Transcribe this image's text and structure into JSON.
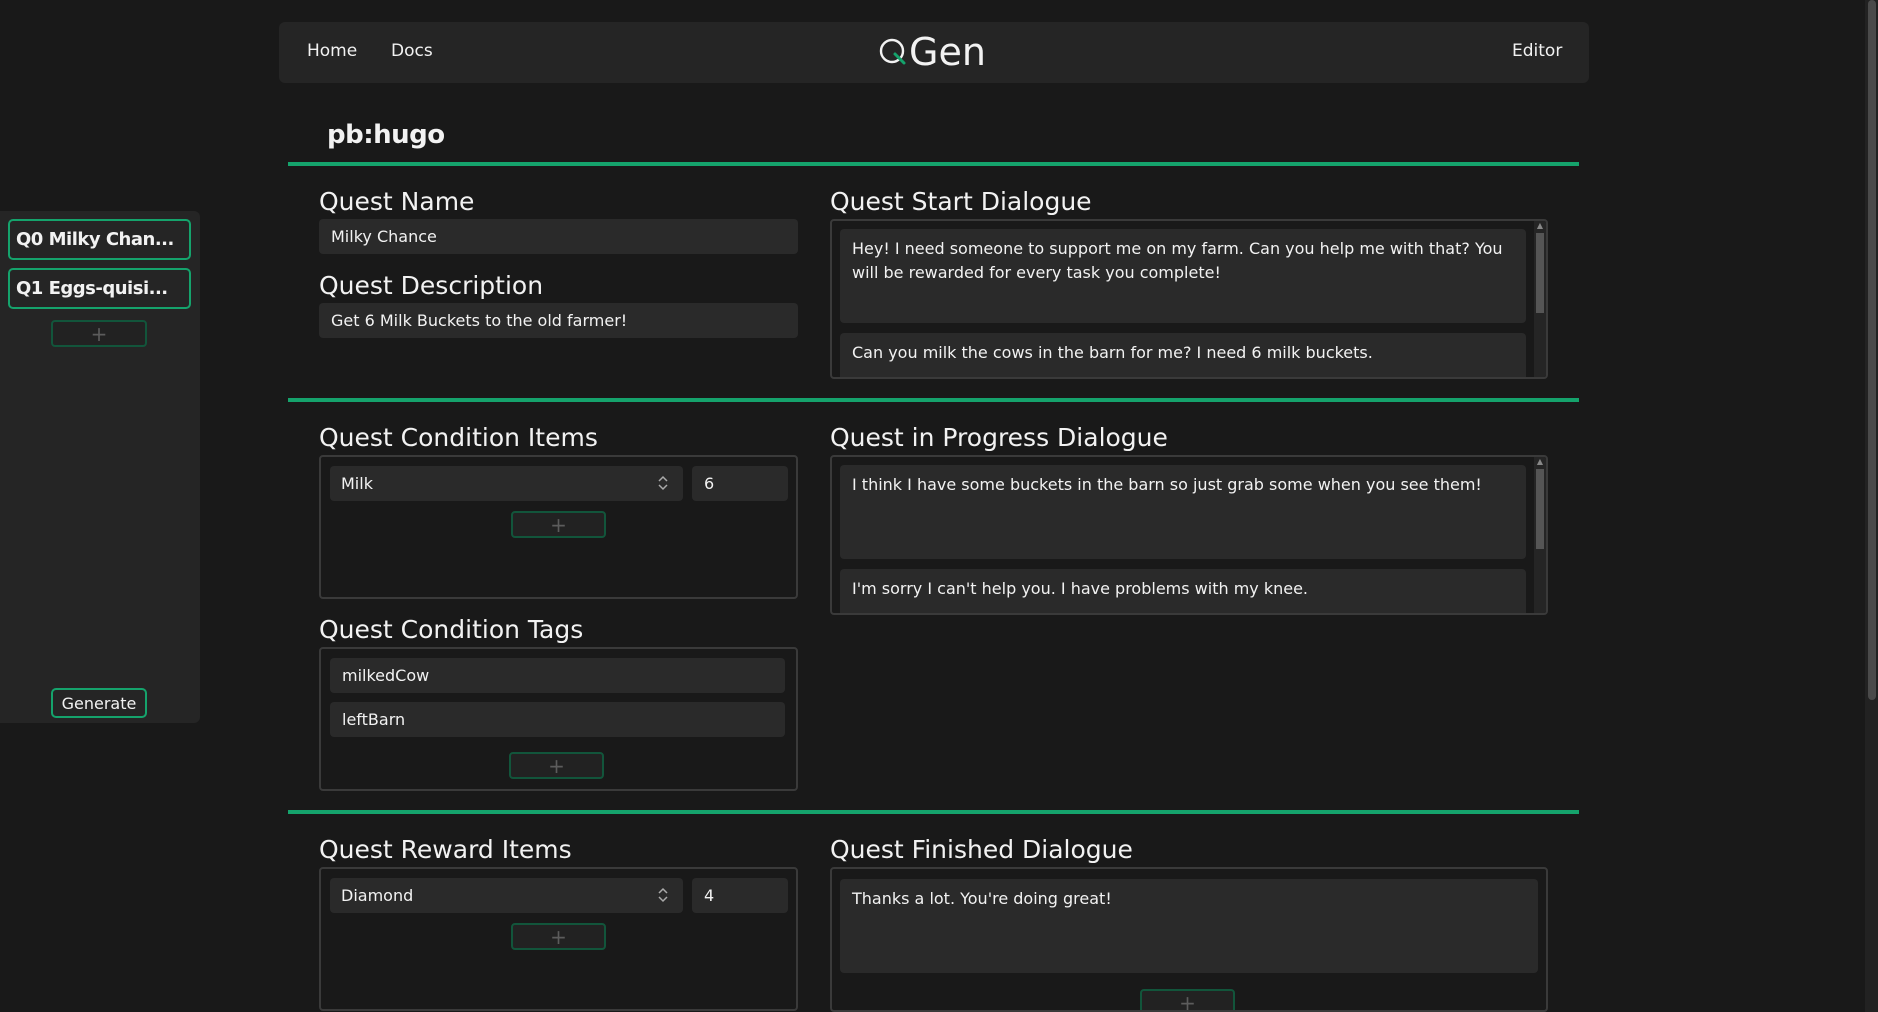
{
  "nav": {
    "home": "Home",
    "docs": "Docs",
    "logo_text": "Gen",
    "editor": "Editor"
  },
  "sidebar": {
    "quests": [
      {
        "id": "Q0",
        "name": "Milky Chan..."
      },
      {
        "id": "Q1",
        "name": "Eggs-quisi..."
      }
    ],
    "add_label": "+",
    "generate_label": "Generate"
  },
  "page": {
    "title": "pb:hugo"
  },
  "quest": {
    "name_label": "Quest Name",
    "name_value": "Milky Chance",
    "description_label": "Quest Description",
    "description_value": "Get 6 Milk Buckets to the old farmer!",
    "start_dialogue_label": "Quest Start Dialogue",
    "start_dialogue": [
      "Hey! I need someone to support me on my farm. Can you help me with that? You will be rewarded for every task you complete!",
      "Can you milk the cows in the barn for me? I need 6 milk buckets."
    ],
    "condition_items_label": "Quest Condition Items",
    "condition_items": [
      {
        "item": "Milk",
        "qty": "6"
      }
    ],
    "progress_dialogue_label": "Quest in Progress Dialogue",
    "progress_dialogue": [
      "I think I have some buckets in the barn so just grab some when you see them!",
      "I'm sorry I can't help you. I have problems with my knee."
    ],
    "condition_tags_label": "Quest Condition Tags",
    "condition_tags": [
      "milkedCow",
      "leftBarn"
    ],
    "reward_items_label": "Quest Reward Items",
    "reward_items": [
      {
        "item": "Diamond",
        "qty": "4"
      }
    ],
    "finished_dialogue_label": "Quest Finished Dialogue",
    "finished_dialogue": [
      "Thanks a lot. You're doing great!"
    ],
    "add_label": "+"
  },
  "colors": {
    "accent": "#15a36c",
    "background": "#191919",
    "panel": "#252525",
    "field": "#2a2a2a"
  },
  "icons": {
    "logo": "q-magnifier-icon",
    "select": "chevron-updown-icon"
  }
}
